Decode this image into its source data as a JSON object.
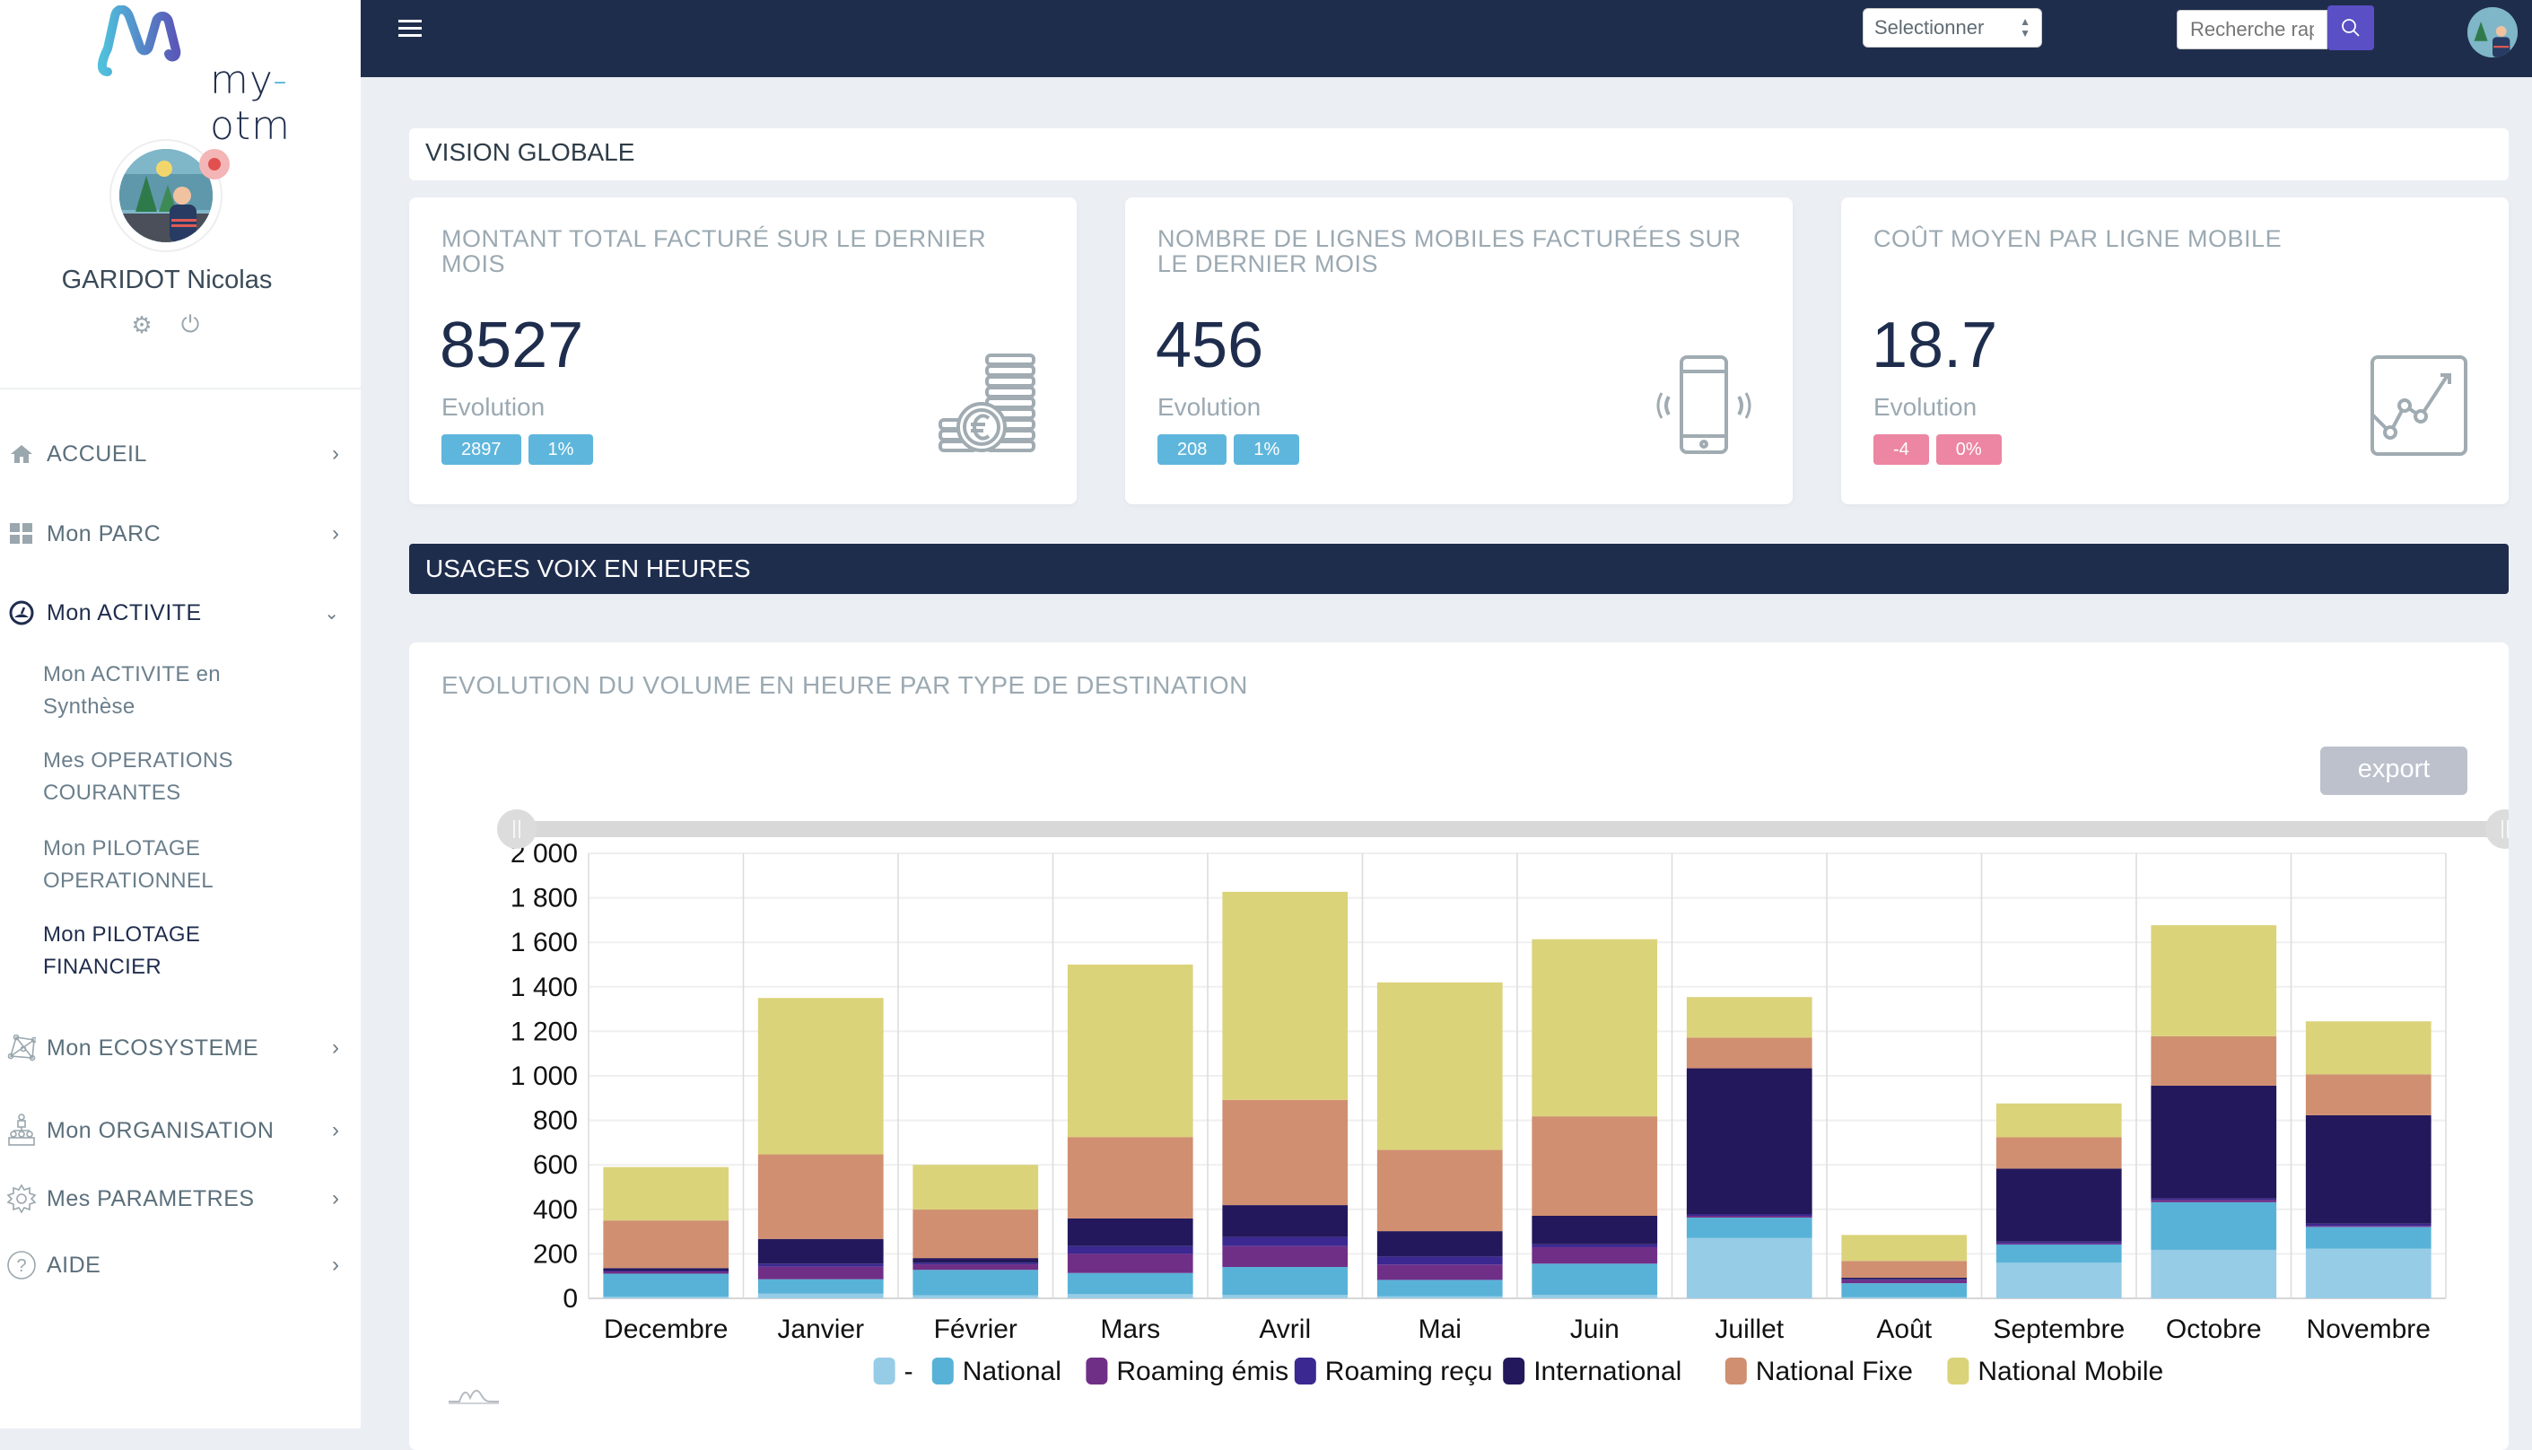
{
  "brand": {
    "logo_text_left": "my",
    "logo_text_dash": "-",
    "logo_text_right": "otm"
  },
  "user": {
    "name": "GARIDOT Nicolas",
    "status_color": "#e0504e"
  },
  "sidebar": {
    "items": [
      {
        "label": "ACCUEIL",
        "icon": "home-icon",
        "chevron": "right"
      },
      {
        "label": "Mon PARC",
        "icon": "grid-icon",
        "chevron": "right"
      },
      {
        "label": "Mon ACTIVITE",
        "icon": "dashboard-icon",
        "chevron": "down",
        "active": true,
        "children": [
          {
            "label_line1": "Mon ACTIVITE en",
            "label_line2": "Synthèse"
          },
          {
            "label_line1": "Mes OPERATIONS",
            "label_line2": "COURANTES"
          },
          {
            "label_line1": "Mon PILOTAGE",
            "label_line2": "OPERATIONNEL"
          },
          {
            "label_line1": "Mon PILOTAGE",
            "label_line2": "FINANCIER",
            "active": true
          }
        ]
      },
      {
        "label": "Mon ECOSYSTEME",
        "icon": "network-icon",
        "chevron": "right"
      },
      {
        "label": "Mon ORGANISATION",
        "icon": "org-chart-icon",
        "chevron": "right"
      },
      {
        "label": "Mes PARAMETRES",
        "icon": "gear-icon",
        "chevron": "right"
      },
      {
        "label": "AIDE",
        "icon": "help-icon",
        "chevron": "right"
      }
    ]
  },
  "topbar": {
    "select_value": "Selectionner",
    "search_placeholder": "Recherche rapide ...",
    "accent": "#5a4fc4",
    "bg": "#1f2d4d"
  },
  "vision": {
    "title": "VISION GLOBALE",
    "cards": [
      {
        "title": "MONTANT TOTAL FACTURÉ SUR LE DERNIER MOIS",
        "value": "8527",
        "evolution_label": "Evolution",
        "badges": [
          "2897",
          "1%"
        ],
        "badge_color": "blue",
        "icon": "coins-euro-icon"
      },
      {
        "title": "NOMBRE DE LIGNES MOBILES FACTURÉES SUR LE DERNIER MOIS",
        "value": "456",
        "evolution_label": "Evolution",
        "badges": [
          "208",
          "1%"
        ],
        "badge_color": "blue",
        "icon": "phone-vibrate-icon"
      },
      {
        "title": "COÛT MOYEN PAR LIGNE MOBILE",
        "value": "18.7",
        "evolution_label": "Evolution",
        "badges": [
          "-4",
          "0%"
        ],
        "badge_color": "pink",
        "icon": "trend-chart-icon"
      }
    ]
  },
  "section": {
    "title": "USAGES VOIX EN HEURES"
  },
  "chart_panel": {
    "title": "EVOLUTION DU VOLUME EN HEURE PAR TYPE DE DESTINATION",
    "export_label": "export"
  },
  "chart_data": {
    "type": "bar",
    "stacked": true,
    "title": "EVOLUTION DU VOLUME EN HEURE PAR TYPE DE DESTINATION",
    "xlabel": "",
    "ylabel": "",
    "ylim": [
      0,
      2000
    ],
    "yticks": [
      0,
      200,
      400,
      600,
      800,
      1000,
      1200,
      1400,
      1600,
      1800,
      2000
    ],
    "ytick_labels": [
      "0",
      "200",
      "400",
      "600",
      "800",
      "1 000",
      "1 200",
      "1 400",
      "1 600",
      "1 800",
      "2 000"
    ],
    "grid": true,
    "legend_position": "bottom",
    "categories": [
      "Decembre",
      "Janvier",
      "Février",
      "Mars",
      "Avril",
      "Mai",
      "Juin",
      "Juillet",
      "Août",
      "Septembre",
      "Octobre",
      "Novembre"
    ],
    "series": [
      {
        "name": "-",
        "color": "#96cce6",
        "values": [
          7,
          21,
          14,
          19,
          15,
          9,
          15,
          271,
          5,
          160,
          218,
          223
        ]
      },
      {
        "name": "National",
        "color": "#58b2d7",
        "values": [
          104,
          65,
          114,
          95,
          126,
          74,
          141,
          92,
          63,
          82,
          214,
          98
        ]
      },
      {
        "name": "Roaming émis",
        "color": "#702f87",
        "values": [
          10,
          56,
          25,
          86,
          94,
          69,
          74,
          8,
          14,
          5,
          10,
          5
        ]
      },
      {
        "name": "Roaming reçu",
        "color": "#3b2890",
        "values": [
          4,
          14,
          7,
          35,
          40,
          36,
          13,
          8,
          4,
          8,
          7,
          10
        ]
      },
      {
        "name": "International",
        "color": "#24185c",
        "values": [
          11,
          111,
          21,
          124,
          144,
          114,
          128,
          655,
          7,
          328,
          507,
          487
        ]
      },
      {
        "name": "National Fixe",
        "color": "#d08f70",
        "values": [
          214,
          380,
          218,
          366,
          473,
          365,
          447,
          138,
          75,
          141,
          222,
          184
        ]
      },
      {
        "name": "National Mobile",
        "color": "#dbd37a",
        "values": [
          240,
          703,
          201,
          775,
          935,
          753,
          796,
          182,
          117,
          152,
          499,
          238
        ]
      }
    ],
    "range_slider": {
      "start": "Decembre",
      "end": "Novembre"
    }
  }
}
